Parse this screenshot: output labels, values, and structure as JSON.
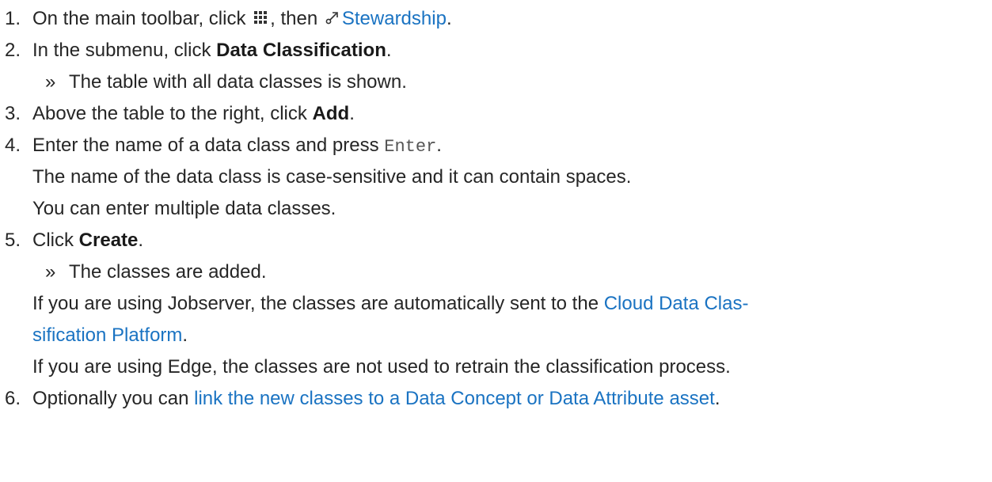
{
  "steps": [
    {
      "num": "1.",
      "text_a": "On the main toolbar, click ",
      "text_b": ", then ",
      "link": "Stewardship",
      "text_c": "."
    },
    {
      "num": "2.",
      "text_a": "In the submenu, click ",
      "bold": "Data Classification",
      "text_c": "."
    },
    {
      "result": "The table with all data classes is shown."
    },
    {
      "num": "3.",
      "text_a": "Above the table to the right, click ",
      "bold": "Add",
      "text_c": "."
    },
    {
      "num": "4.",
      "text_a": "Enter the name of a data class and press ",
      "mono": "Enter",
      "text_c": "."
    },
    {
      "para_1": "The name of the data class is case-sensitive and it can contain spaces.",
      "para_2": "You can enter multiple data classes."
    },
    {
      "num": "5.",
      "text_a": "Click ",
      "bold": "Create",
      "text_c": "."
    },
    {
      "result": "The classes are added."
    },
    {
      "para_a": "If you are using Jobserver, the classes are automatically sent to the ",
      "link_a": "Cloud Data Clas-",
      "link_b": "sification Platform",
      "para_c": "."
    },
    {
      "para": "If you are using Edge, the classes are not used to retrain the classification process."
    },
    {
      "num": "6.",
      "text_a": "Optionally you can ",
      "link": "link the new classes to a Data Concept or Data Attribute asset",
      "text_c": "."
    }
  ],
  "raquo": "»",
  "colors": {
    "text": "#262626",
    "link": "#1a73c2",
    "mono": "#555555"
  },
  "icons": {
    "apps": "apps-grid-icon",
    "stewardship": "stewardship-icon"
  }
}
